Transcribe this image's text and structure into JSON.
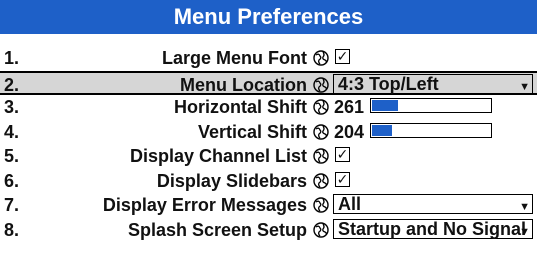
{
  "title": "Menu Preferences",
  "accent_color": "#1e60c8",
  "rows": [
    {
      "num": "1.",
      "label": "Large Menu Font",
      "control": "checkbox",
      "checked": true
    },
    {
      "num": "2.",
      "label": "Menu Location",
      "control": "dropdown",
      "value": "4:3 Top/Left",
      "selected": true
    },
    {
      "num": "3.",
      "label": "Horizontal Shift",
      "control": "slider",
      "value": "261",
      "level_percent": 22
    },
    {
      "num": "4.",
      "label": "Vertical Shift",
      "control": "slider",
      "value": "204",
      "level_percent": 17
    },
    {
      "num": "5.",
      "label": "Display Channel List",
      "control": "checkbox",
      "checked": true
    },
    {
      "num": "6.",
      "label": "Display Slidebars",
      "control": "checkbox",
      "checked": true
    },
    {
      "num": "7.",
      "label": "Display Error Messages",
      "control": "dropdown",
      "value": "All"
    },
    {
      "num": "8.",
      "label": "Splash Screen Setup",
      "control": "dropdown",
      "value": "Startup and No Signal"
    }
  ],
  "icons": {
    "help": "globe-icon",
    "check": "✓",
    "dropdown_arrow": "▼"
  }
}
